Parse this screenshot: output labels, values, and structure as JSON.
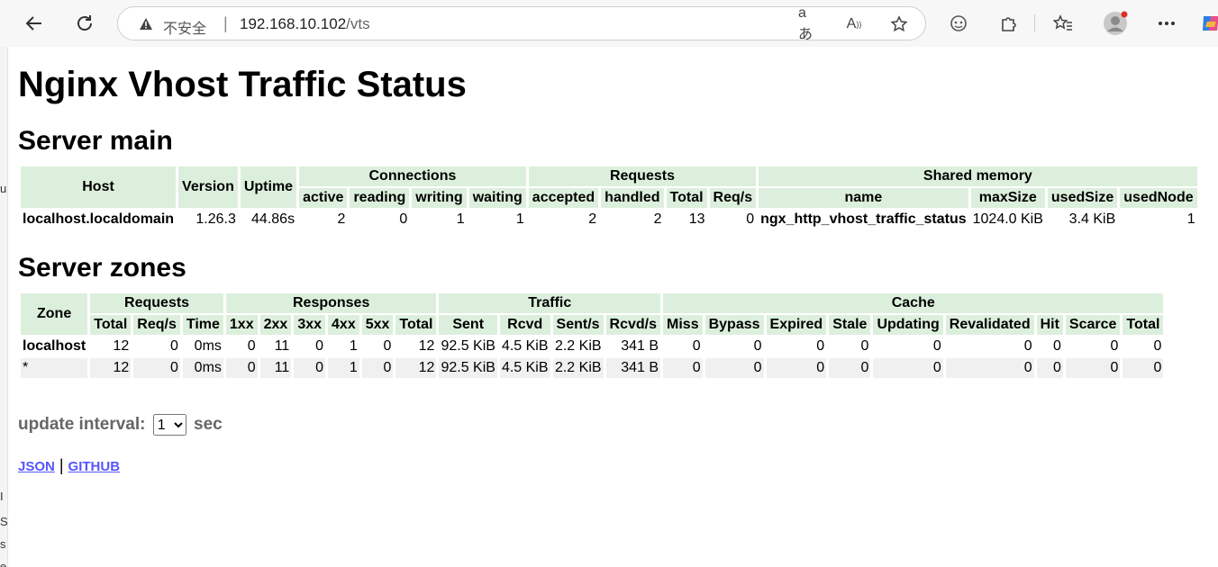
{
  "browser": {
    "insecure_label": "不安全",
    "separator": "|",
    "url_host": "192.168.10.102",
    "url_path": "/vts"
  },
  "page": {
    "title": "Nginx Vhost Traffic Status",
    "server_main_heading": "Server main",
    "server_zones_heading": "Server zones"
  },
  "server_main": {
    "headers": {
      "host": "Host",
      "version": "Version",
      "uptime": "Uptime",
      "connections": "Connections",
      "requests": "Requests",
      "shared_memory": "Shared memory",
      "active": "active",
      "reading": "reading",
      "writing": "writing",
      "waiting": "waiting",
      "accepted": "accepted",
      "handled": "handled",
      "total": "Total",
      "req_s": "Req/s",
      "name": "name",
      "max_size": "maxSize",
      "used_size": "usedSize",
      "used_node": "usedNode"
    },
    "row": {
      "host": "localhost.localdomain",
      "version": "1.26.3",
      "uptime": "44.86s",
      "active": "2",
      "reading": "0",
      "writing": "1",
      "waiting": "1",
      "accepted": "2",
      "handled": "2",
      "total": "13",
      "req_s": "0",
      "name": "ngx_http_vhost_traffic_status",
      "max_size": "1024.0 KiB",
      "used_size": "3.4 KiB",
      "used_node": "1"
    }
  },
  "server_zones": {
    "headers": {
      "zone": "Zone",
      "requests": "Requests",
      "responses": "Responses",
      "traffic": "Traffic",
      "cache": "Cache",
      "req_total": "Total",
      "req_s": "Req/s",
      "time": "Time",
      "r1xx": "1xx",
      "r2xx": "2xx",
      "r3xx": "3xx",
      "r4xx": "4xx",
      "r5xx": "5xx",
      "resp_total": "Total",
      "sent": "Sent",
      "rcvd": "Rcvd",
      "sent_s": "Sent/s",
      "rcvd_s": "Rcvd/s",
      "miss": "Miss",
      "bypass": "Bypass",
      "expired": "Expired",
      "stale": "Stale",
      "updating": "Updating",
      "revalidated": "Revalidated",
      "hit": "Hit",
      "scarce": "Scarce",
      "cache_total": "Total"
    },
    "rows": [
      {
        "zone": "localhost",
        "total": "12",
        "req_s": "0",
        "time": "0ms",
        "r1xx": "0",
        "r2xx": "11",
        "r3xx": "0",
        "r4xx": "1",
        "r5xx": "0",
        "resp_total": "12",
        "sent": "92.5 KiB",
        "rcvd": "4.5 KiB",
        "sent_s": "2.2 KiB",
        "rcvd_s": "341 B",
        "miss": "0",
        "bypass": "0",
        "expired": "0",
        "stale": "0",
        "updating": "0",
        "revalidated": "0",
        "hit": "0",
        "scarce": "0",
        "cache_total": "0"
      },
      {
        "zone": "*",
        "total": "12",
        "req_s": "0",
        "time": "0ms",
        "r1xx": "0",
        "r2xx": "11",
        "r3xx": "0",
        "r4xx": "1",
        "r5xx": "0",
        "resp_total": "12",
        "sent": "92.5 KiB",
        "rcvd": "4.5 KiB",
        "sent_s": "2.2 KiB",
        "rcvd_s": "341 B",
        "miss": "0",
        "bypass": "0",
        "expired": "0",
        "stale": "0",
        "updating": "0",
        "revalidated": "0",
        "hit": "0",
        "scarce": "0",
        "cache_total": "0"
      }
    ]
  },
  "update_interval": {
    "label": "update interval:",
    "selected": "1",
    "unit": "sec"
  },
  "links": {
    "json": "JSON",
    "separator": "|",
    "github": "GITHUB"
  },
  "colors": {
    "header_bg": "#dcefdc",
    "alt_row_bg": "#f0f0f0",
    "link": "#5555ff"
  }
}
